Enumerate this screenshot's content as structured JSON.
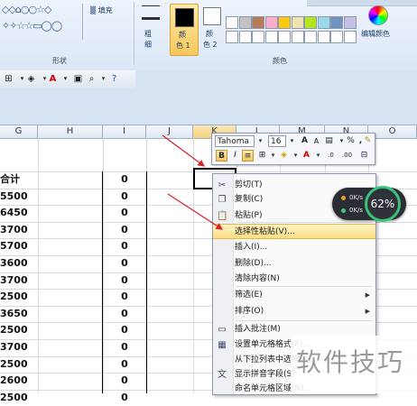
{
  "ribbon": {
    "shapes_group_label": "形状",
    "fill_label": "填充",
    "outline_label_line1": "粗",
    "outline_label_line2": "细",
    "color1_label_line1": "颜",
    "color1_label_line2": "色 1",
    "color2_label_line1": "颜",
    "color2_label_line2": "色 2",
    "colors_group_label": "颜色",
    "edit_colors_label": "编辑颜色",
    "palette_row1": [
      "#ffffff",
      "#c3c3c3",
      "#b97a57",
      "#ffaec9",
      "#ffc90e",
      "#efe4b0",
      "#b5e61d",
      "#99d9ea",
      "#7092be",
      "#c8bfe7",
      "#ffffff",
      "#ffffff",
      "#ffffff",
      "#ffffff",
      "#ffffff"
    ],
    "palette_row2": [
      "#ffffff",
      "#ffffff",
      "#ffffff",
      "#ffffff",
      "#ffffff",
      "#ffffff",
      "#ffffff",
      "#ffffff",
      "#ffffff",
      "#ffffff",
      "#ffffff",
      "#ffffff",
      "#ffffff",
      "#ffffff",
      "#ffffff"
    ]
  },
  "sheet": {
    "columns": [
      "G",
      "H",
      "I",
      "J",
      "K",
      "L",
      "M",
      "N",
      "O"
    ],
    "g_values": [
      "合计",
      "5500",
      "6450",
      "3700",
      "5700",
      "3600",
      "3700",
      "2500",
      "3650",
      "2500",
      "3700",
      "2500",
      "2600",
      "2500"
    ],
    "i_values": [
      "0",
      "0",
      "0",
      "0",
      "0",
      "0",
      "0",
      "0",
      "0",
      "0",
      "0",
      "0",
      "0",
      "0"
    ]
  },
  "minibar": {
    "font_name": "Tahoma",
    "font_size": "16",
    "grow_font": "A",
    "shrink_font": "A",
    "currency": "$",
    "percent": "%",
    "comma": ",",
    "bold": "B",
    "italic": "I",
    "inc_decimal": ".0",
    "dec_decimal": ".00"
  },
  "context_menu": {
    "items": [
      {
        "label": "剪切(T)",
        "icon": "scissors-icon",
        "glyph": "✂"
      },
      {
        "label": "复制(C)",
        "icon": "copy-icon",
        "glyph": "❐"
      },
      {
        "label": "粘贴(P)",
        "icon": "paste-icon",
        "glyph": "📋"
      },
      {
        "label": "选择性粘贴(V)...",
        "icon": "",
        "glyph": ""
      },
      {
        "label": "插入(I)...",
        "icon": "",
        "glyph": ""
      },
      {
        "label": "删除(D)...",
        "icon": "",
        "glyph": ""
      },
      {
        "label": "清除内容(N)",
        "icon": "",
        "glyph": ""
      },
      {
        "label": "筛选(E)",
        "icon": "",
        "glyph": ""
      },
      {
        "label": "排序(O)",
        "icon": "",
        "glyph": ""
      },
      {
        "label": "插入批注(M)",
        "icon": "comment-icon",
        "glyph": "▭"
      },
      {
        "label": "设置单元格格式(F)...",
        "icon": "format-cells-icon",
        "glyph": "▦"
      },
      {
        "label": "从下拉列表中选择(K)...",
        "icon": "",
        "glyph": ""
      },
      {
        "label": "显示拼音字段(S)",
        "icon": "phonetic-icon",
        "glyph": "文"
      },
      {
        "label": "命名单元格区域(R)...",
        "icon": "",
        "glyph": ""
      }
    ]
  },
  "speed_widget": {
    "upload": "0K/s",
    "download": "0K/s",
    "percent": "62%"
  },
  "watermark": "软件技巧",
  "colors": {
    "accent_yellow": "#f8c75c",
    "gauge_green": "#39c27a",
    "arrow_red": "#d9232b"
  }
}
